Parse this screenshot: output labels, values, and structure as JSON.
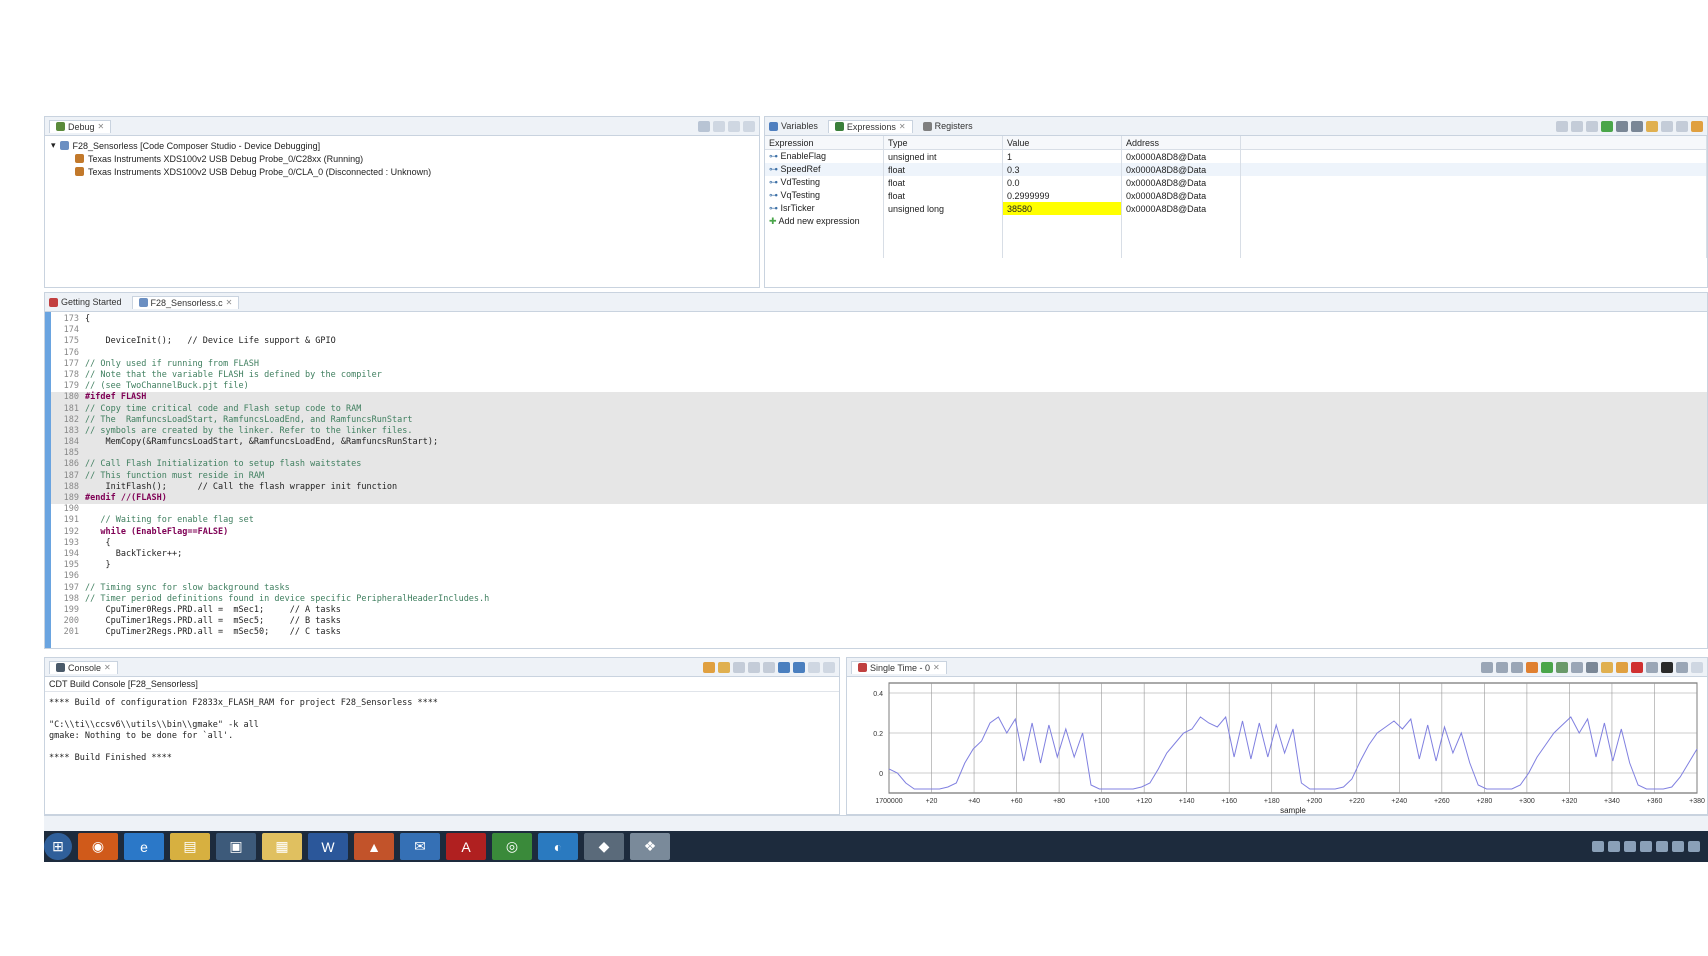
{
  "debug": {
    "tab": "Debug",
    "tree": [
      "F28_Sensorless [Code Composer Studio - Device Debugging]",
      "Texas Instruments XDS100v2 USB Debug Probe_0/C28xx (Running)",
      "Texas Instruments XDS100v2 USB Debug Probe_0/CLA_0 (Disconnected : Unknown)"
    ]
  },
  "expressions": {
    "tabs": [
      "Variables",
      "Expressions",
      "Registers"
    ],
    "columns": [
      "Expression",
      "Type",
      "Value",
      "Address"
    ],
    "rows": [
      {
        "expr": "EnableFlag",
        "type": "unsigned int",
        "value": "1",
        "addr": "0x0000A8D8@Data"
      },
      {
        "expr": "SpeedRef",
        "type": "float",
        "value": "0.3",
        "addr": "0x0000A8D8@Data"
      },
      {
        "expr": "VdTesting",
        "type": "float",
        "value": "0.0",
        "addr": "0x0000A8D8@Data"
      },
      {
        "expr": "VqTesting",
        "type": "float",
        "value": "0.2999999",
        "addr": "0x0000A8D8@Data"
      },
      {
        "expr": "IsrTicker",
        "type": "unsigned long",
        "value": "38580",
        "addr": "0x0000A8D8@Data",
        "highlight": "#ffff00"
      }
    ],
    "add_new": "Add new expression"
  },
  "editor": {
    "tabs": [
      "Getting Started",
      "F28_Sensorless.c"
    ],
    "lines": [
      {
        "n": "173",
        "t": "{"
      },
      {
        "n": "174",
        "t": ""
      },
      {
        "n": "175",
        "t": "    DeviceInit();   // Device Life support & GPIO"
      },
      {
        "n": "176",
        "t": ""
      },
      {
        "n": "177",
        "t": "// Only used if running from FLASH"
      },
      {
        "n": "178",
        "t": "// Note that the variable FLASH is defined by the compiler"
      },
      {
        "n": "179",
        "t": "// (see TwoChannelBuck.pjt file)"
      },
      {
        "n": "180",
        "t": "#ifdef FLASH"
      },
      {
        "n": "181",
        "t": "// Copy time critical code and Flash setup code to RAM"
      },
      {
        "n": "182",
        "t": "// The  RamfuncsLoadStart, RamfuncsLoadEnd, and RamfuncsRunStart"
      },
      {
        "n": "183",
        "t": "// symbols are created by the linker. Refer to the linker files."
      },
      {
        "n": "184",
        "t": "    MemCopy(&RamfuncsLoadStart, &RamfuncsLoadEnd, &RamfuncsRunStart);"
      },
      {
        "n": "185",
        "t": ""
      },
      {
        "n": "186",
        "t": "// Call Flash Initialization to setup flash waitstates"
      },
      {
        "n": "187",
        "t": "// This function must reside in RAM"
      },
      {
        "n": "188",
        "t": "    InitFlash();      // Call the flash wrapper init function"
      },
      {
        "n": "189",
        "t": "#endif //(FLASH)"
      },
      {
        "n": "190",
        "t": ""
      },
      {
        "n": "191",
        "t": "   // Waiting for enable flag set"
      },
      {
        "n": "192",
        "t": "   while (EnableFlag==FALSE)"
      },
      {
        "n": "193",
        "t": "    {"
      },
      {
        "n": "194",
        "t": "      BackTicker++;"
      },
      {
        "n": "195",
        "t": "    }"
      },
      {
        "n": "196",
        "t": ""
      },
      {
        "n": "197",
        "t": "// Timing sync for slow background tasks"
      },
      {
        "n": "198",
        "t": "// Timer period definitions found in device specific PeripheralHeaderIncludes.h"
      },
      {
        "n": "199",
        "t": "    CpuTimer0Regs.PRD.all =  mSec1;     // A tasks"
      },
      {
        "n": "200",
        "t": "    CpuTimer1Regs.PRD.all =  mSec5;     // B tasks"
      },
      {
        "n": "201",
        "t": "    CpuTimer2Regs.PRD.all =  mSec50;    // C tasks"
      }
    ]
  },
  "console": {
    "tab": "Console",
    "subtitle": "CDT Build Console [F28_Sensorless]",
    "lines": [
      "**** Build of configuration F2833x_FLASH_RAM for project F28_Sensorless ****",
      "",
      "\"C:\\\\ti\\\\ccsv6\\\\utils\\\\bin\\\\gmake\" -k all",
      "gmake: Nothing to be done for `all'.",
      "",
      "**** Build Finished ****"
    ]
  },
  "graph": {
    "tab": "Single Time - 0",
    "xlabel": "sample",
    "yticks": [
      "0.4",
      "0.2",
      "0"
    ],
    "xticks": [
      "1700000",
      "+20",
      "+40",
      "+60",
      "+80",
      "+100",
      "+120",
      "+140",
      "+160",
      "+180",
      "+200",
      "+220",
      "+240",
      "+260",
      "+280",
      "+300",
      "+320",
      "+340",
      "+360",
      "+380"
    ]
  },
  "chart_data": {
    "type": "line",
    "title": "",
    "xlabel": "sample",
    "ylabel": "",
    "ylim": [
      -0.1,
      0.45
    ],
    "grid": true,
    "series": [
      {
        "values": [
          0.02,
          0.0,
          -0.05,
          -0.08,
          -0.08,
          -0.08,
          -0.08,
          -0.07,
          -0.05,
          0.05,
          0.12,
          0.16,
          0.25,
          0.28,
          0.2,
          0.27,
          0.06,
          0.25,
          0.05,
          0.24,
          0.08,
          0.22,
          0.08,
          0.2,
          -0.06,
          -0.08,
          -0.08,
          -0.08,
          -0.08,
          -0.08,
          -0.07,
          -0.05,
          0.02,
          0.1,
          0.15,
          0.2,
          0.22,
          0.28,
          0.25,
          0.23,
          0.28,
          0.08,
          0.26,
          0.07,
          0.25,
          0.08,
          0.24,
          0.1,
          0.22,
          -0.05,
          -0.08,
          -0.08,
          -0.08,
          -0.08,
          -0.07,
          -0.03,
          0.06,
          0.14,
          0.2,
          0.23,
          0.26,
          0.22,
          0.27,
          0.07,
          0.24,
          0.06,
          0.23,
          0.1,
          0.2,
          0.05,
          -0.06,
          -0.08,
          -0.08,
          -0.08,
          -0.08,
          -0.06,
          0.0,
          0.08,
          0.14,
          0.2,
          0.24,
          0.28,
          0.2,
          0.27,
          0.08,
          0.25,
          0.06,
          0.22,
          0.05,
          -0.06,
          -0.08,
          -0.08,
          -0.08,
          -0.07,
          -0.02,
          0.05,
          0.12
        ]
      }
    ]
  },
  "taskbar": {
    "items": [
      "start-icon",
      "firefox-icon",
      "ie-icon",
      "explorer-icon",
      "app-icon",
      "folder-icon",
      "word-icon",
      "matlab-icon",
      "outlook-icon",
      "acrobat-icon",
      "chrome-icon",
      "ccs-icon",
      "box-icon",
      "cube-icon"
    ]
  },
  "colors": {
    "accent": "#3a6ea5",
    "yellow": "#ffff00",
    "plot": "#8080e0"
  }
}
